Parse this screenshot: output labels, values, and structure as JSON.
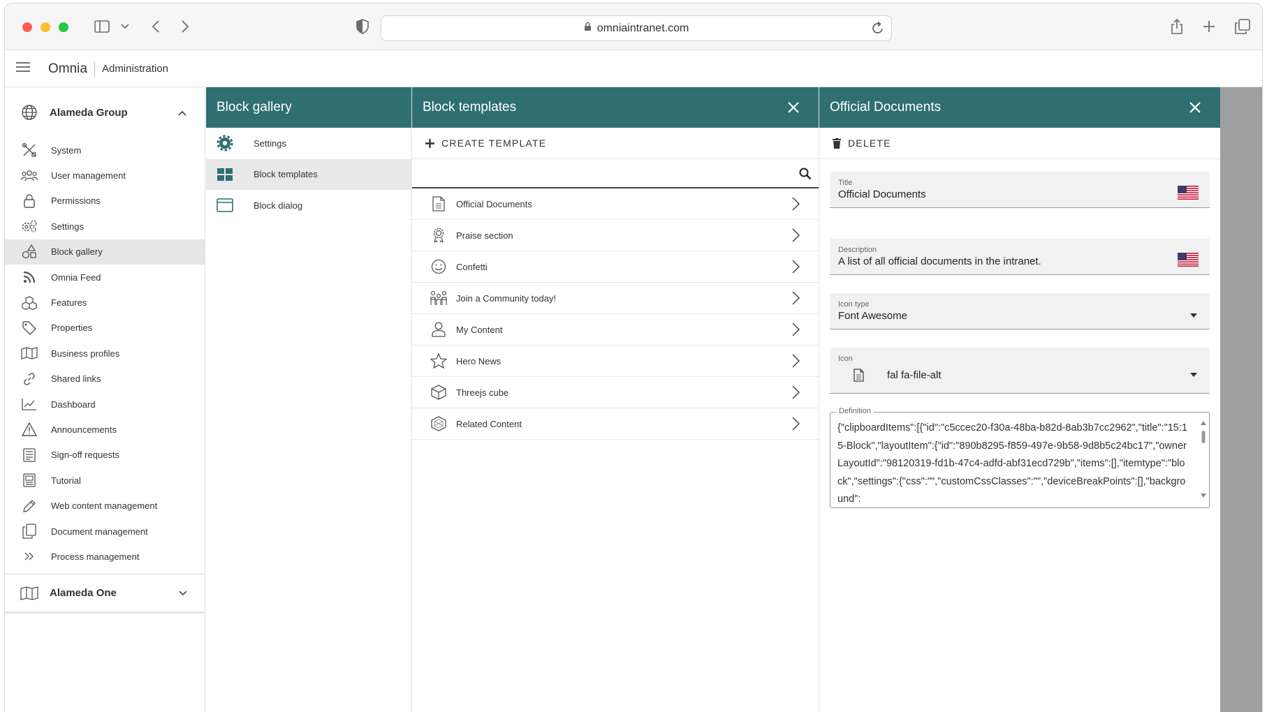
{
  "browser": {
    "url": "omniaintranet.com"
  },
  "app": {
    "brand": "Omnia",
    "section": "Administration"
  },
  "sidebar": {
    "group_top": "Alameda Group",
    "items": [
      {
        "label": "System",
        "icon": "tools-icon"
      },
      {
        "label": "User management",
        "icon": "users-icon"
      },
      {
        "label": "Permissions",
        "icon": "lock-icon"
      },
      {
        "label": "Settings",
        "icon": "gears-icon"
      },
      {
        "label": "Block gallery",
        "icon": "shapes-icon"
      },
      {
        "label": "Omnia Feed",
        "icon": "rss-icon"
      },
      {
        "label": "Features",
        "icon": "cubes-icon"
      },
      {
        "label": "Properties",
        "icon": "tag-icon"
      },
      {
        "label": "Business profiles",
        "icon": "map-icon"
      },
      {
        "label": "Shared links",
        "icon": "link-icon"
      },
      {
        "label": "Dashboard",
        "icon": "chart-icon"
      },
      {
        "label": "Announcements",
        "icon": "warning-icon"
      },
      {
        "label": "Sign-off requests",
        "icon": "list-icon"
      },
      {
        "label": "Tutorial",
        "icon": "book-icon"
      },
      {
        "label": "Web content management",
        "icon": "pen-icon"
      },
      {
        "label": "Document management",
        "icon": "copy-icon"
      },
      {
        "label": "Process management",
        "icon": "chevrons-right-icon"
      }
    ],
    "group_bottom": "Alameda One"
  },
  "block_gallery": {
    "title": "Block gallery",
    "items": [
      {
        "label": "Settings"
      },
      {
        "label": "Block templates"
      },
      {
        "label": "Block dialog"
      }
    ]
  },
  "block_templates": {
    "title": "Block templates",
    "create_label": "CREATE TEMPLATE",
    "search_placeholder": "",
    "templates": [
      {
        "label": "Official Documents",
        "icon": "file-icon"
      },
      {
        "label": "Praise section",
        "icon": "award-icon"
      },
      {
        "label": "Confetti",
        "icon": "smile-icon"
      },
      {
        "label": "Join a Community today!",
        "icon": "people-icon"
      },
      {
        "label": "My Content",
        "icon": "user-icon"
      },
      {
        "label": "Hero News",
        "icon": "star-icon"
      },
      {
        "label": "Threejs cube",
        "icon": "cube-icon"
      },
      {
        "label": "Related Content",
        "icon": "cube-outline-icon"
      }
    ]
  },
  "detail": {
    "title": "Official Documents",
    "delete_label": "DELETE",
    "title_label": "Title",
    "title_value": "Official Documents",
    "description_label": "Description",
    "description_value": "A list of all official documents in the intranet.",
    "icon_type_label": "Icon type",
    "icon_type_value": "Font Awesome",
    "icon_label": "Icon",
    "icon_value": "fal fa-file-alt",
    "definition_label": "Definition",
    "definition_value": "{\"clipboardItems\":[{\"id\":\"c5ccec20-f30a-48ba-b82d-8ab3b7cc2962\",\"title\":\"15:15-Block\",\"layoutItem\":{\"id\":\"890b8295-f859-497e-9b58-9d8b5c24bc17\",\"ownerLayoutId\":\"98120319-fd1b-47c4-adfd-abf31ecd729b\",\"items\":[],\"itemtype\":\"block\",\"settings\":{\"css\":\"\",\"customCssClasses\":\"\",\"deviceBreakPoints\":[],\"background\":"
  },
  "colors": {
    "accent": "#2f6f72"
  }
}
